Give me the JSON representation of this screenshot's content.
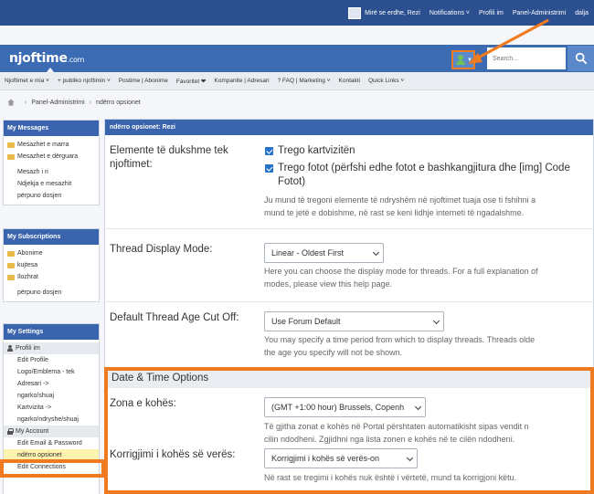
{
  "topbar": {
    "greeting": "Mirë se erdhe, Rezi",
    "links": [
      "Notifications ˅",
      "Profili im",
      "Panel-Administrimi",
      "dalja"
    ]
  },
  "header": {
    "logo_main": "njoftime",
    "logo_suffix": ".com",
    "search_placeholder": "Search..."
  },
  "nav": {
    "items": [
      "Njoftimet e mia ˅",
      "+ publiko njoftimin ˅",
      "Postime | Abonime",
      "Favoritet ❤",
      "Kompanite | Adresari",
      "? FAQ | Marketing ˅",
      "Kontakti",
      "Quick Links ˅"
    ]
  },
  "breadcrumb": {
    "items": [
      "Panel-Administrimi",
      "ndërro opsionet"
    ]
  },
  "sidebar": {
    "messages": {
      "title": "My Messages",
      "folders": [
        "Mesazhet e marra",
        "Mesazhet e dërguara"
      ],
      "links": [
        "Mesazh i ri",
        "Ndjekja e mesazhit",
        "përpuno dosjen"
      ]
    },
    "subscriptions": {
      "title": "My Subscriptions",
      "folders": [
        "Abonime",
        "kujtesa",
        "Ilozhrat"
      ],
      "links": [
        "përpuno dosjen"
      ]
    },
    "settings": {
      "title": "My Settings",
      "profile_section": "Profili im",
      "profile_links": [
        "Edit Profile",
        "Logo/Emblema - tek",
        "Adresari ->",
        "ngarko/shuaj",
        "Kartvizita ->",
        "ngarko/ndryshe/shuaj"
      ],
      "account_section": "My Account",
      "account_links": [
        "Edit Email & Password",
        "ndërro opsionet",
        "Edit Connections"
      ]
    }
  },
  "main": {
    "title": "ndërro opsionet: Rezi",
    "visible_elements": {
      "label": "Elemente të dukshme tek njoftimet:",
      "option1": "Trego kartvizitën",
      "option2": "Trego fotot (përfshi edhe fotot e bashkangjitura dhe [img] Code",
      "option2_cont": "Fotot)",
      "desc1": "Ju mund të tregoni elemente të ndryshëm në njoftimet tuaja ose ti fshihni a",
      "desc2": "mund te jetë e dobishme, në rast se keni lidhje interneti të ngadalshme."
    },
    "thread_display": {
      "label": "Thread Display Mode:",
      "value": "Linear - Oldest First",
      "desc1": "Here you can choose the display mode for threads. For a full explanation of",
      "desc2": "modes, please view this help page."
    },
    "thread_age": {
      "label": "Default Thread Age Cut Off:",
      "value": "Use Forum Default",
      "desc1": "You may specify a time period from which to display threads. Threads olde",
      "desc2": "the age you specify will not be shown."
    },
    "datetime": {
      "section_title": "Date & Time Options",
      "tz_label": "Zona e kohës:",
      "tz_value": "(GMT +1:00 hour) Brussels, Copenh",
      "tz_desc1": "Të gjitha zonat e kohës në Portal përshtaten automatikisht sipas vendit n",
      "tz_desc2": "cilin ndodheni. Zgjidhni nga lista zonen e kohës në te cilën ndodheni.",
      "dst_label": "Korrigjimi i kohës së verës:",
      "dst_value": "Korrigjimi i kohës së verës-on",
      "dst_desc": "Në rast se tregimi i kohës nuk është i vërtetë, mund ta korrigjoni këtu."
    }
  },
  "colors": {
    "brand_blue": "#3b6bb3",
    "dark_blue": "#2b4f8f",
    "annotation_orange": "#f07a1f",
    "checkbox_blue": "#2673c9"
  }
}
